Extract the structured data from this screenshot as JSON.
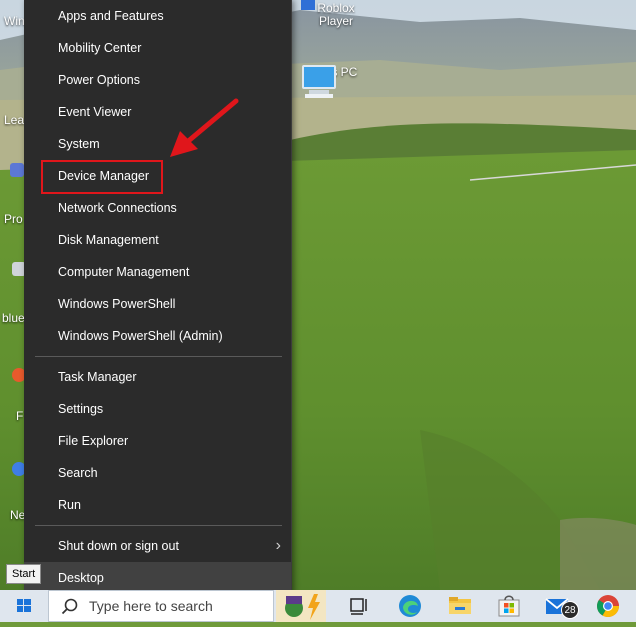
{
  "desktop": {
    "icons": [
      {
        "label": "Roblox Player"
      },
      {
        "label": "This PC"
      }
    ],
    "left_labels": [
      "Wind",
      "Lea this",
      "Pro",
      "blue",
      "F",
      "Ne"
    ]
  },
  "menu": {
    "items_group1": [
      "Apps and Features",
      "Mobility Center",
      "Power Options",
      "Event Viewer",
      "System",
      "Device Manager",
      "Network Connections",
      "Disk Management",
      "Computer Management",
      "Windows PowerShell",
      "Windows PowerShell (Admin)"
    ],
    "items_group2": [
      "Task Manager",
      "Settings",
      "File Explorer",
      "Search",
      "Run"
    ],
    "items_group3": [
      "Shut down or sign out",
      "Desktop"
    ],
    "highlighted_item": "Device Manager",
    "submenu_chevron": "›"
  },
  "tooltip": {
    "start": "Start"
  },
  "taskbar": {
    "search_placeholder": "Type here to search",
    "mail_badge": "28"
  },
  "colors": {
    "menu_bg": "#2b2b2b",
    "highlight_border": "#e0161b",
    "arrow": "#e0161b",
    "taskbar_bg": "#dfe6ee"
  }
}
